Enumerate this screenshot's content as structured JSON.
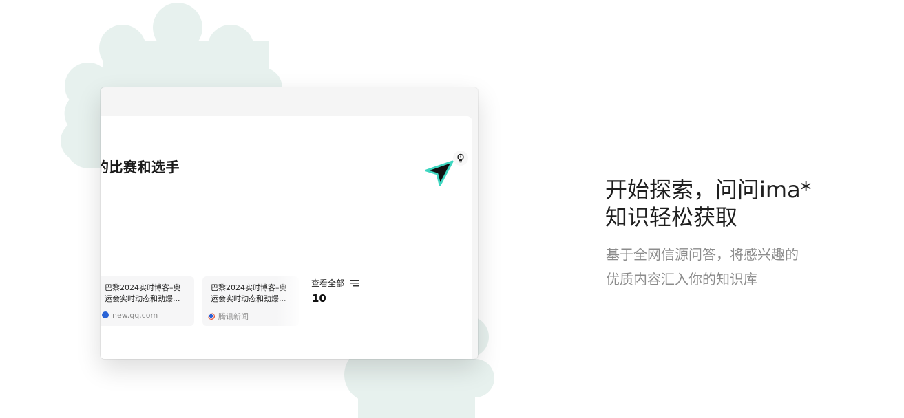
{
  "card": {
    "question_title": "的比赛和选手",
    "sources": [
      {
        "title": "巴黎2024实时博客–奥运会实时动态和劲爆...",
        "site": "new.qq.com",
        "site_icon": "planet-icon"
      },
      {
        "title": "巴黎2024实时博客–奥运会实时动态和劲爆...",
        "site": "腾讯新闻",
        "site_icon": "tencent-news-icon"
      }
    ],
    "view_all_label": "查看全部",
    "view_all_count": "10"
  },
  "promo": {
    "headline_line1": "开始探索，问问ima*",
    "headline_line2": "知识轻松获取",
    "sub_line1": "基于全网信源问答，将感兴趣的",
    "sub_line2": "优质内容汇入你的知识库"
  },
  "colors": {
    "blob": "#e7f1ee",
    "cursor_outline": "#3ed6c0",
    "qq_blue": "#2a63d6"
  }
}
